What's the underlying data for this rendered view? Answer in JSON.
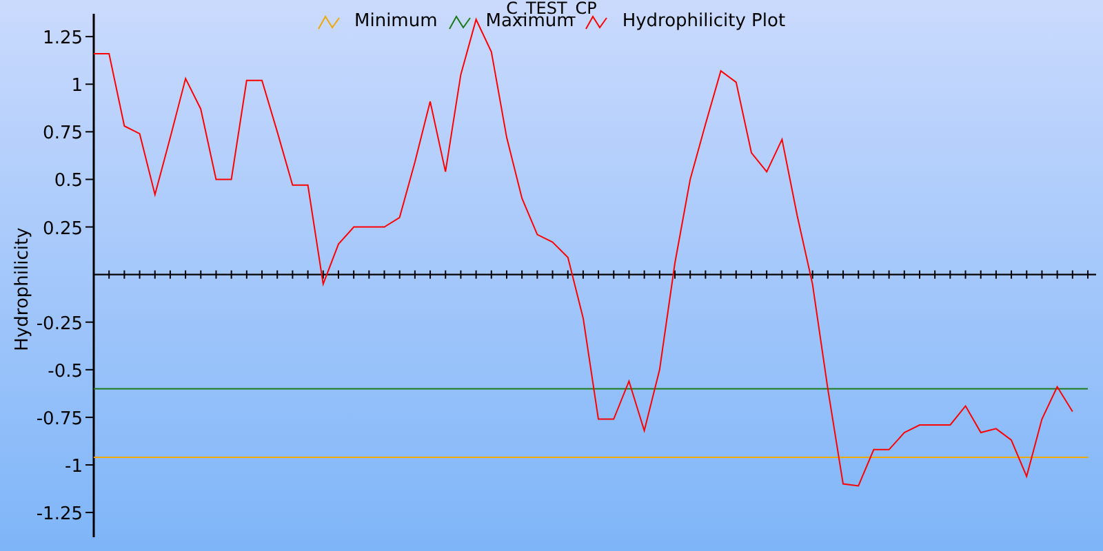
{
  "chart_data": {
    "type": "line",
    "title": "C_TEST_CP",
    "ylabel": "Hydrophilicity",
    "ylim": [
      -1.38,
      1.37
    ],
    "legend": true,
    "yticks": [
      -1.25,
      -1,
      -0.75,
      -0.5,
      -0.25,
      0.25,
      0.5,
      0.75,
      1,
      1.25
    ],
    "series": [
      {
        "name": "Minimum",
        "color": "#f0a800",
        "values": [
          -0.96,
          -0.96,
          -0.96,
          -0.96,
          -0.96,
          -0.96,
          -0.96,
          -0.96,
          -0.96,
          -0.96,
          -0.96,
          -0.96,
          -0.96,
          -0.96,
          -0.96,
          -0.96,
          -0.96,
          -0.96,
          -0.96,
          -0.96,
          -0.96,
          -0.96,
          -0.96,
          -0.96,
          -0.96,
          -0.96,
          -0.96,
          -0.96,
          -0.96,
          -0.96,
          -0.96,
          -0.96,
          -0.96,
          -0.96,
          -0.96,
          -0.96,
          -0.96,
          -0.96,
          -0.96,
          -0.96,
          -0.96,
          -0.96,
          -0.96,
          -0.96,
          -0.96,
          -0.96,
          -0.96,
          -0.96,
          -0.96,
          -0.96,
          -0.96,
          -0.96,
          -0.96,
          -0.96,
          -0.96,
          -0.96,
          -0.96,
          -0.96,
          -0.96,
          -0.96,
          -0.96,
          -0.96,
          -0.96,
          -0.96,
          -0.96,
          -0.96
        ]
      },
      {
        "name": "Maximum",
        "color": "#1a7a1a",
        "values": [
          -0.6,
          -0.6,
          -0.6,
          -0.6,
          -0.6,
          -0.6,
          -0.6,
          -0.6,
          -0.6,
          -0.6,
          -0.6,
          -0.6,
          -0.6,
          -0.6,
          -0.6,
          -0.6,
          -0.6,
          -0.6,
          -0.6,
          -0.6,
          -0.6,
          -0.6,
          -0.6,
          -0.6,
          -0.6,
          -0.6,
          -0.6,
          -0.6,
          -0.6,
          -0.6,
          -0.6,
          -0.6,
          -0.6,
          -0.6,
          -0.6,
          -0.6,
          -0.6,
          -0.6,
          -0.6,
          -0.6,
          -0.6,
          -0.6,
          -0.6,
          -0.6,
          -0.6,
          -0.6,
          -0.6,
          -0.6,
          -0.6,
          -0.6,
          -0.6,
          -0.6,
          -0.6,
          -0.6,
          -0.6,
          -0.6,
          -0.6,
          -0.6,
          -0.6,
          -0.6,
          -0.6,
          -0.6,
          -0.6,
          -0.6,
          -0.6,
          -0.6
        ]
      },
      {
        "name": "Hydrophilicity Plot",
        "color": "#ff0000",
        "values": [
          1.16,
          1.16,
          0.78,
          0.74,
          0.42,
          0.72,
          1.03,
          0.87,
          0.5,
          0.5,
          1.02,
          1.02,
          0.75,
          0.47,
          0.47,
          -0.05,
          0.16,
          0.25,
          0.25,
          0.25,
          0.3,
          0.59,
          0.91,
          0.54,
          1.05,
          1.34,
          1.17,
          0.72,
          0.4,
          0.21,
          0.17,
          0.09,
          -0.23,
          -0.76,
          -0.76,
          -0.56,
          -0.82,
          -0.5,
          0.06,
          0.5,
          0.79,
          1.07,
          1.01,
          0.64,
          0.54,
          0.71,
          0.31,
          -0.05,
          -0.6,
          -1.1,
          -1.11,
          -0.92,
          -0.92,
          -0.83,
          -0.79,
          -0.79,
          -0.79,
          -0.69,
          -0.83,
          -0.81,
          -0.87,
          -1.06,
          -0.76,
          -0.59,
          -0.72
        ]
      }
    ]
  }
}
